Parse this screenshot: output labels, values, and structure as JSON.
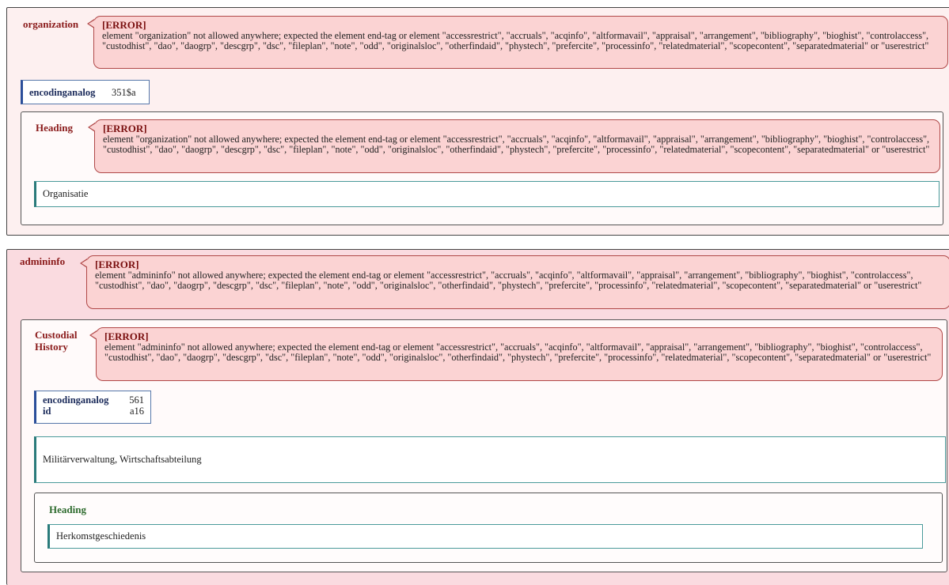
{
  "error_title": "[ERROR]",
  "block1": {
    "element": "organization",
    "error": "element \"organization\" not allowed anywhere; expected the element end-tag or element \"accessrestrict\", \"accruals\", \"acqinfo\", \"altformavail\", \"appraisal\", \"arrangement\", \"bibliography\", \"bioghist\", \"controlaccess\", \"custodhist\", \"dao\", \"daogrp\", \"descgrp\", \"dsc\", \"fileplan\", \"note\", \"odd\", \"originalsloc\", \"otherfindaid\", \"phystech\", \"prefercite\", \"processinfo\", \"relatedmaterial\", \"scopecontent\", \"separatedmaterial\" or \"userestrict\"",
    "attributes": [
      {
        "key": "encodinganalog",
        "value": "351$a"
      }
    ],
    "heading": {
      "label": "Heading",
      "error": "element \"organization\" not allowed anywhere; expected the element end-tag or element \"accessrestrict\", \"accruals\", \"acqinfo\", \"altformavail\", \"appraisal\", \"arrangement\", \"bibliography\", \"bioghist\", \"controlaccess\", \"custodhist\", \"dao\", \"daogrp\", \"descgrp\", \"dsc\", \"fileplan\", \"note\", \"odd\", \"originalsloc\", \"otherfindaid\", \"phystech\", \"prefercite\", \"processinfo\", \"relatedmaterial\", \"scopecontent\", \"separatedmaterial\" or \"userestrict\"",
      "text": "Organisatie"
    }
  },
  "block2": {
    "element": "admininfo",
    "error": "element \"admininfo\" not allowed anywhere; expected the element end-tag or element \"accessrestrict\", \"accruals\", \"acqinfo\", \"altformavail\", \"appraisal\", \"arrangement\", \"bibliography\", \"bioghist\", \"controlaccess\", \"custodhist\", \"dao\", \"daogrp\", \"descgrp\", \"dsc\", \"fileplan\", \"note\", \"odd\", \"originalsloc\", \"otherfindaid\", \"phystech\", \"prefercite\", \"processinfo\", \"relatedmaterial\", \"scopecontent\", \"separatedmaterial\" or \"userestrict\"",
    "custodial": {
      "label": "Custodial History",
      "error": "element \"admininfo\" not allowed anywhere; expected the element end-tag or element \"accessrestrict\", \"accruals\", \"acqinfo\", \"altformavail\", \"appraisal\", \"arrangement\", \"bibliography\", \"bioghist\", \"controlaccess\", \"custodhist\", \"dao\", \"daogrp\", \"descgrp\", \"dsc\", \"fileplan\", \"note\", \"odd\", \"originalsloc\", \"otherfindaid\", \"phystech\", \"prefercite\", \"processinfo\", \"relatedmaterial\", \"scopecontent\", \"separatedmaterial\" or \"userestrict\"",
      "attributes": [
        {
          "key": "encodinganalog",
          "value": "561"
        },
        {
          "key": "id",
          "value": "a16"
        }
      ],
      "text": "Militärverwaltung, Wirtschaftsabteilung",
      "heading": {
        "label": "Heading",
        "text": "Herkomstgeschiedenis"
      }
    }
  }
}
